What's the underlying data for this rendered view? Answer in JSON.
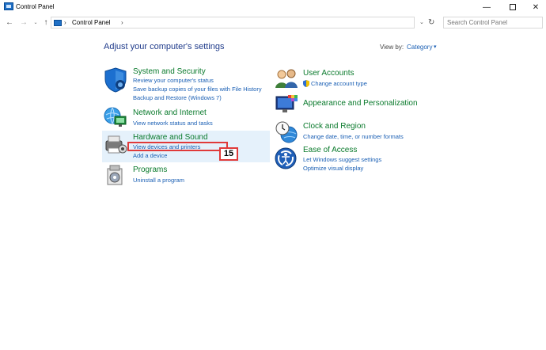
{
  "window": {
    "title": "Control Panel"
  },
  "window_controls": {
    "minimize": "—",
    "restore": "☐",
    "close": "✕"
  },
  "navigation": {
    "back": "←",
    "forward": "→",
    "recent": "⌄",
    "up": "↑",
    "refresh": "↻",
    "dropdown": "⌄"
  },
  "address": {
    "sep": "›",
    "crumb": "Control Panel"
  },
  "search": {
    "placeholder": "Search Control Panel"
  },
  "header": {
    "title": "Adjust your computer's settings",
    "view_by_label": "View by:",
    "view_by_value": "Category",
    "caret": "▾"
  },
  "categories_left": [
    {
      "title": "System and Security",
      "icon": "shield-icon",
      "links": [
        "Review your computer's status",
        "Save backup copies of your files with File History",
        "Backup and Restore (Windows 7)"
      ]
    },
    {
      "title": "Network and Internet",
      "icon": "network-globe-icon",
      "links": [
        "View network status and tasks"
      ]
    },
    {
      "title": "Hardware and Sound",
      "icon": "printer-speaker-icon",
      "links": [
        "View devices and printers",
        "Add a device"
      ]
    },
    {
      "title": "Programs",
      "icon": "programs-icon",
      "links": [
        "Uninstall a program"
      ]
    }
  ],
  "categories_right": [
    {
      "title": "User Accounts",
      "icon": "users-icon",
      "links": [
        "Change account type"
      ]
    },
    {
      "title": "Appearance and Personalization",
      "icon": "display-palette-icon",
      "links": []
    },
    {
      "title": "Clock and Region",
      "icon": "clock-globe-icon",
      "links": [
        "Change date, time, or number formats"
      ]
    },
    {
      "title": "Ease of Access",
      "icon": "ease-of-access-icon",
      "links": [
        "Let Windows suggest settings",
        "Optimize visual display"
      ]
    }
  ],
  "annotation": {
    "label": "15"
  },
  "colors": {
    "accent": "#1a5fb4",
    "category_green": "#0a7a2c",
    "highlight": "#e5f1fb",
    "annotation_red": "#e03a3a"
  }
}
